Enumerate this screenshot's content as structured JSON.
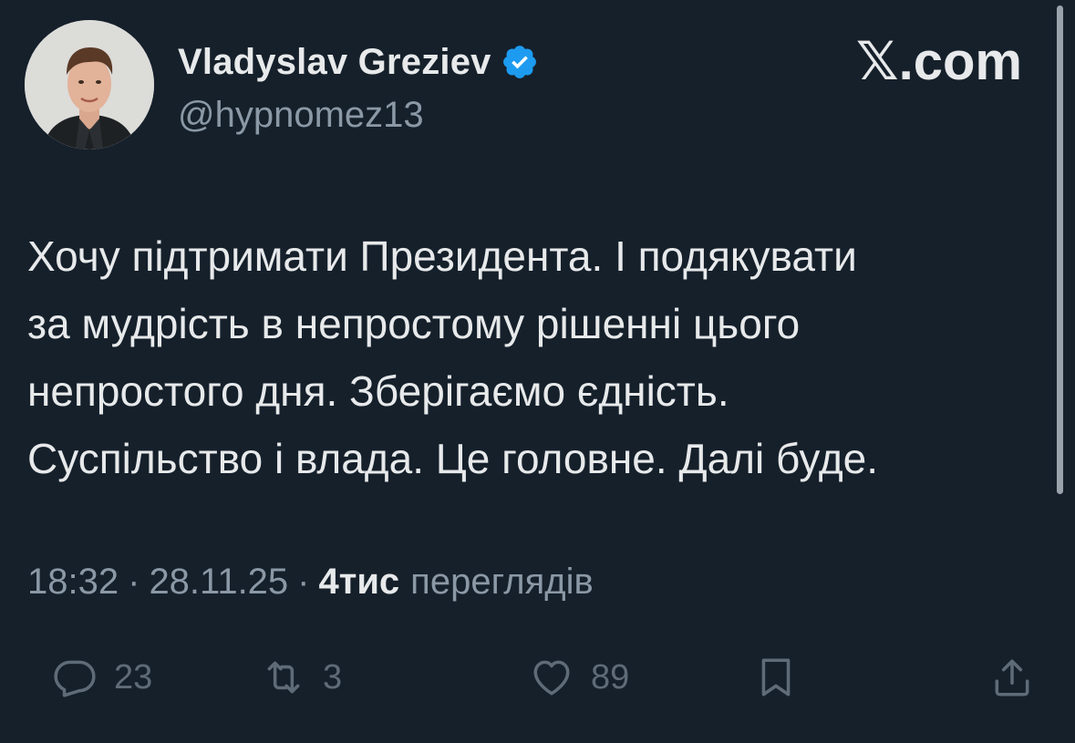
{
  "author": {
    "display_name": "Vladyslav Greziev",
    "handle": "@hypnomez13",
    "verified": true
  },
  "brand": "𝕏.com",
  "tweet": {
    "lines": [
      "Хочу підтримати Президента. І подякувати",
      "за мудрість в непростому рішенні цього",
      "непростого дня. Зберігаємо єдність.",
      "Суспільство і влада. Це головне. Далі буде."
    ]
  },
  "meta": {
    "time": "18:32",
    "separator": "·",
    "date": "28.11.25",
    "views_count": "4тис",
    "views_label": "переглядів"
  },
  "actions": {
    "replies": {
      "icon": "reply-icon",
      "count": "23"
    },
    "reposts": {
      "icon": "repost-icon",
      "count": "3"
    },
    "likes": {
      "icon": "heart-icon",
      "count": "89"
    },
    "bookmark": {
      "icon": "bookmark-icon"
    },
    "share": {
      "icon": "share-icon"
    }
  },
  "colors": {
    "background": "#15202b",
    "primary_text": "#e7e9ea",
    "secondary_text": "#8b98a5",
    "action_icons": "#5f6b76",
    "verified_badge": "#1d9bf0"
  }
}
